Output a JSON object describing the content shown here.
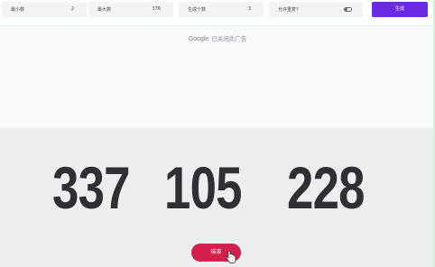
{
  "toolbar": {
    "min_label": "最小数",
    "min_value": "2",
    "max_label": "最大数",
    "max_value": "376",
    "count_label": "生成个数",
    "count_value": "3",
    "repeat_label": "允许重复?",
    "generate_label": "生成"
  },
  "ad": {
    "brand": "Google",
    "message": "已关闭此广告"
  },
  "result": {
    "numbers": [
      "337",
      "105",
      "228"
    ]
  },
  "actions": {
    "stop_label": "结束"
  },
  "colors": {
    "accent": "#6a2be2",
    "stop": "#d41f4e",
    "digits": "#2f3033"
  }
}
